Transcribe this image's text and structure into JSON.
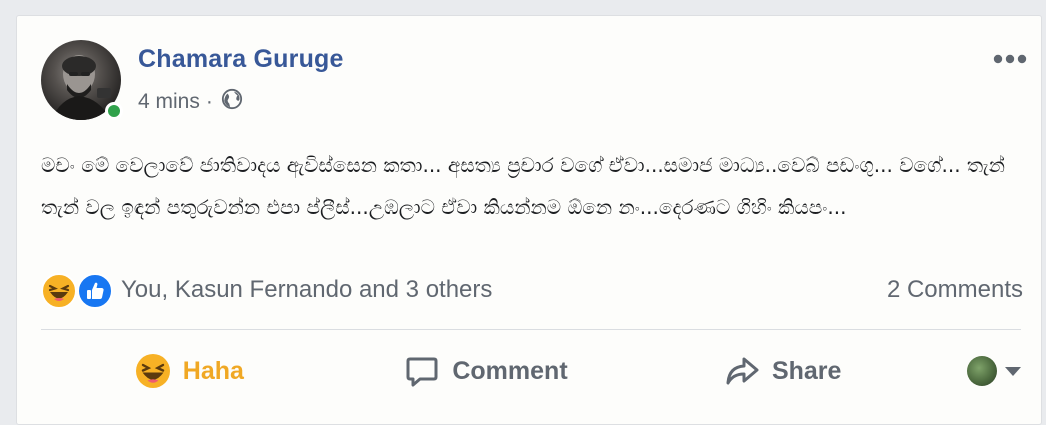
{
  "post": {
    "author_name": "Chamara Guruge",
    "timestamp": "4 mins",
    "separator": "·",
    "privacy_icon": "globe-icon",
    "more_options_icon": "more-horizontal-icon",
    "online": true,
    "text": "මචං මේ වෙලාවේ ජාතිවාදය ඇවිස්සෙන කතා... අසත්‍ය ප්‍රචාර වගේ ඒවා...සමාජ මාධ්‍ය..වෙබ් පඩංගු... වගේ... තැන් තැන් වල ඉඳන් පතුරුවන්න එපා ප්ලීස්...උඹලාට ඒවා කියන්නම ඕනෙ නං...දෙරණට ගිහිං කියපං..."
  },
  "reactions": {
    "icons": [
      "haha-emoji-icon",
      "like-thumb-icon"
    ],
    "summary": "You, Kasun Fernando and 3 others",
    "comments_count": "2 Comments"
  },
  "actions": {
    "haha_label": "Haha",
    "comment_label": "Comment",
    "share_label": "Share"
  },
  "colors": {
    "author_link": "#385898",
    "secondary_text": "#606770",
    "haha_active": "#f0a824",
    "like_blue": "#1877f2",
    "online_green": "#31a24c"
  }
}
